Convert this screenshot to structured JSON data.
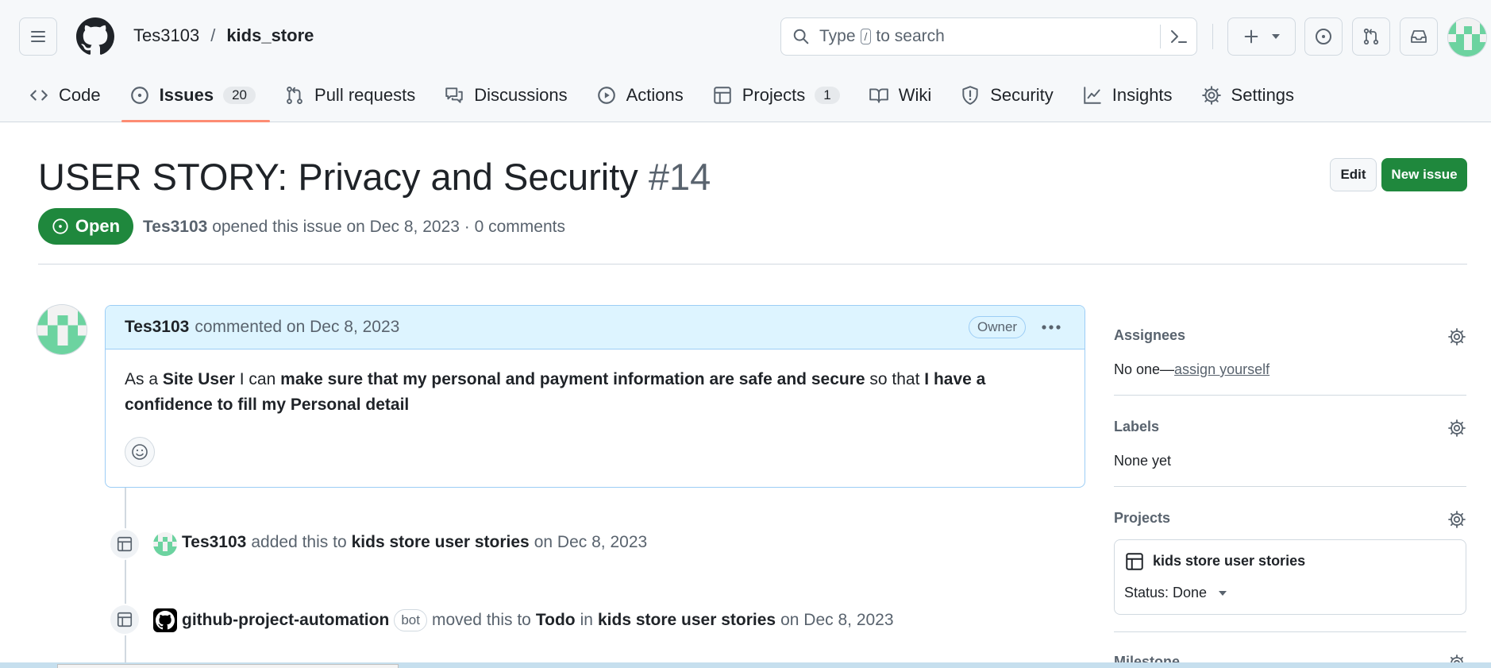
{
  "header": {
    "owner": "Tes3103",
    "separator": "/",
    "repo": "kids_store",
    "search": {
      "prefix": "Type",
      "key": "/",
      "suffix": "to search"
    }
  },
  "tabs": [
    {
      "label": "Code",
      "icon": "code-icon"
    },
    {
      "label": "Issues",
      "count": "20",
      "icon": "issue-opened-icon",
      "active": true
    },
    {
      "label": "Pull requests",
      "icon": "git-pull-request-icon"
    },
    {
      "label": "Discussions",
      "icon": "comment-discussion-icon"
    },
    {
      "label": "Actions",
      "icon": "play-icon"
    },
    {
      "label": "Projects",
      "count": "1",
      "icon": "table-icon"
    },
    {
      "label": "Wiki",
      "icon": "book-icon"
    },
    {
      "label": "Security",
      "icon": "shield-icon"
    },
    {
      "label": "Insights",
      "icon": "graph-icon"
    },
    {
      "label": "Settings",
      "icon": "gear-icon"
    }
  ],
  "issue": {
    "title": "USER STORY: Privacy and Security",
    "number": "#14",
    "state": "Open",
    "author": "Tes3103",
    "opened_text": "opened this issue on Dec 8, 2023 · 0 comments",
    "edit_label": "Edit",
    "new_issue_label": "New issue"
  },
  "comment": {
    "author": "Tes3103",
    "meta": "commented on Dec 8, 2023",
    "role_badge": "Owner",
    "body": {
      "p1": "As a",
      "b1": "Site User",
      "p2": "I can",
      "b2": "make sure that my personal and payment information are safe and secure",
      "p3": "so that",
      "b3": "I have a confidence to fill my Personal detail"
    }
  },
  "timeline": [
    {
      "actor": "Tes3103",
      "t1": "added this to",
      "target": "kids store user stories",
      "t2": "on Dec 8, 2023"
    },
    {
      "actor": "github-project-automation",
      "badge": "bot",
      "t1": "moved this to",
      "column": "Todo",
      "t_in": "in",
      "target": "kids store user stories",
      "t2": "on Dec 8, 2023"
    }
  ],
  "sidebar": {
    "assignees": {
      "heading": "Assignees",
      "value": "No one—",
      "link": "assign yourself"
    },
    "labels": {
      "heading": "Labels",
      "value": "None yet"
    },
    "projects": {
      "heading": "Projects",
      "project_name": "kids store user stories",
      "status": "Status: Done"
    },
    "milestone": {
      "heading": "Milestone"
    }
  },
  "colors": {
    "accent_green": "#1f883d",
    "tab_underline": "#fd8c73",
    "comment_header_bg": "#ddf4ff",
    "comment_border": "#9ccdf5"
  }
}
